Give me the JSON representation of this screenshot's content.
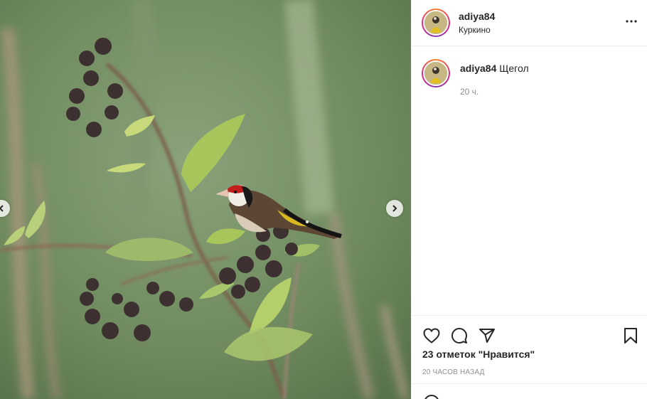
{
  "post": {
    "username": "adiya84",
    "location": "Куркино",
    "caption_text": "Щегол",
    "caption_time": "20 ч.",
    "likes_text": "23 отметок \"Нравится\"",
    "post_date": "20 часов назад"
  },
  "icons": {
    "more": "more-options-icon",
    "like": "heart-icon",
    "comment": "comment-icon",
    "share": "paper-plane-icon",
    "save": "bookmark-icon",
    "prev": "chevron-left-icon",
    "next": "chevron-right-icon",
    "emoji": "emoji-icon"
  },
  "colors": {
    "story_ring_start": "#f58529",
    "story_ring_end": "#dd2a7b",
    "secondary_text": "#8e8e8e",
    "divider": "#efefef"
  }
}
